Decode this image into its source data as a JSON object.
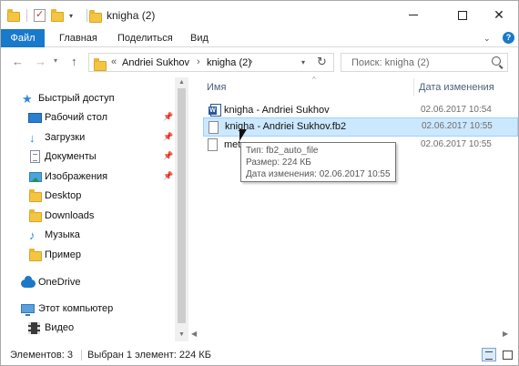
{
  "window": {
    "title": "knigha (2)",
    "qat_dropdown": "▾",
    "min": "",
    "close": "✕"
  },
  "ribbon": {
    "tabs": [
      "Файл",
      "Главная",
      "Поделиться",
      "Вид"
    ],
    "expand": "⌄",
    "help": "?"
  },
  "nav": {
    "back": "←",
    "forward": "→",
    "recent": "▾",
    "up": "↑"
  },
  "address": {
    "overflow": "«",
    "segments": [
      "Andriei Sukhov",
      "knigha (2)"
    ],
    "arrows": "›",
    "dropdown": "▾",
    "refresh": "↻"
  },
  "search": {
    "placeholder": "Поиск: knigha (2)"
  },
  "sidebar": {
    "items": [
      {
        "label": "Быстрый доступ",
        "icon": "star-icon"
      },
      {
        "label": "Рабочий стол",
        "icon": "desktop-icon",
        "pinned": true
      },
      {
        "label": "Загрузки",
        "icon": "download-icon",
        "pinned": true
      },
      {
        "label": "Документы",
        "icon": "documents-icon",
        "pinned": true
      },
      {
        "label": "Изображения",
        "icon": "pictures-icon",
        "pinned": true
      },
      {
        "label": "Desktop",
        "icon": "folder-icon"
      },
      {
        "label": "Downloads",
        "icon": "folder-icon"
      },
      {
        "label": "Музыка",
        "icon": "music-icon"
      },
      {
        "label": "Пример",
        "icon": "folder-icon"
      },
      {
        "label": "OneDrive",
        "icon": "onedrive-icon"
      },
      {
        "label": "Этот компьютер",
        "icon": "computer-icon"
      },
      {
        "label": "Видео",
        "icon": "video-icon"
      }
    ],
    "pin_glyph": "📌"
  },
  "filelist": {
    "columns": {
      "name": "Имя",
      "date": "Дата изменения",
      "sort_glyph": "^"
    },
    "rows": [
      {
        "name": "knigha - Andriei Sukhov",
        "date": "02.06.2017 10:54",
        "icon": "word-document-icon",
        "selected": false
      },
      {
        "name": "knigha - Andriei Sukhov.fb2",
        "date": "02.06.2017 10:55",
        "icon": "file-icon",
        "selected": true
      },
      {
        "name": "met",
        "date": "02.06.2017 10:55",
        "icon": "file-icon",
        "selected": false
      }
    ]
  },
  "tooltip": {
    "type": "Тип: fb2_auto_file",
    "size": "Размер: 224 КБ",
    "modified": "Дата изменения: 02.06.2017 10:55"
  },
  "scroll": {
    "up": "▲",
    "down": "▼",
    "left": "◀",
    "right": "▶"
  },
  "status": {
    "count": "Элементов: 3",
    "selection": "Выбран 1 элемент: 224 КБ"
  },
  "colors": {
    "accent": "#1979ca",
    "selection": "#cce8ff",
    "selection_border": "#99d1ff"
  }
}
